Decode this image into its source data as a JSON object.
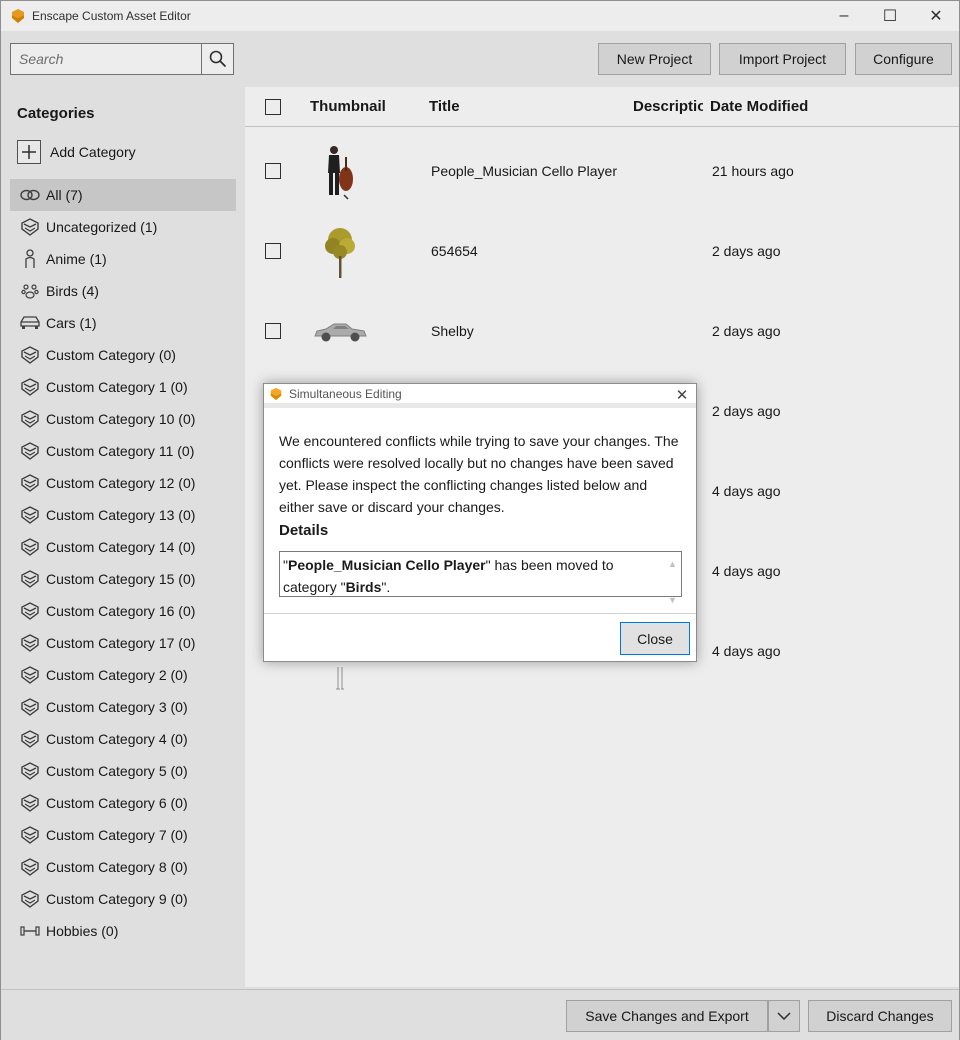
{
  "window": {
    "title": "Enscape Custom Asset Editor",
    "accent": "#f5a623"
  },
  "toolbar": {
    "search_placeholder": "Search",
    "new_project": "New Project",
    "import_project": "Import Project",
    "configure": "Configure"
  },
  "sidebar": {
    "heading": "Categories",
    "add_category": "Add Category",
    "items": [
      {
        "label": "All (7)",
        "icon": "link-icon"
      },
      {
        "label": "Uncategorized (1)",
        "icon": "category-icon"
      },
      {
        "label": "Anime (1)",
        "icon": "person-icon"
      },
      {
        "label": "Birds (4)",
        "icon": "paw-icon"
      },
      {
        "label": "Cars (1)",
        "icon": "car-icon"
      },
      {
        "label": "Custom Category (0)",
        "icon": "category-icon"
      },
      {
        "label": "Custom Category 1 (0)",
        "icon": "category-icon"
      },
      {
        "label": "Custom Category 10 (0)",
        "icon": "category-icon"
      },
      {
        "label": "Custom Category 11 (0)",
        "icon": "category-icon"
      },
      {
        "label": "Custom Category 12 (0)",
        "icon": "category-icon"
      },
      {
        "label": "Custom Category 13 (0)",
        "icon": "category-icon"
      },
      {
        "label": "Custom Category 14 (0)",
        "icon": "category-icon"
      },
      {
        "label": "Custom Category 15 (0)",
        "icon": "category-icon"
      },
      {
        "label": "Custom Category 16 (0)",
        "icon": "category-icon"
      },
      {
        "label": "Custom Category 17 (0)",
        "icon": "category-icon"
      },
      {
        "label": "Custom Category 2 (0)",
        "icon": "category-icon"
      },
      {
        "label": "Custom Category 3 (0)",
        "icon": "category-icon"
      },
      {
        "label": "Custom Category 4 (0)",
        "icon": "category-icon"
      },
      {
        "label": "Custom Category 5 (0)",
        "icon": "category-icon"
      },
      {
        "label": "Custom Category 6 (0)",
        "icon": "category-icon"
      },
      {
        "label": "Custom Category 7 (0)",
        "icon": "category-icon"
      },
      {
        "label": "Custom Category 8 (0)",
        "icon": "category-icon"
      },
      {
        "label": "Custom Category 9 (0)",
        "icon": "category-icon"
      },
      {
        "label": "Hobbies (0)",
        "icon": "dumbbell-icon"
      }
    ]
  },
  "grid": {
    "columns": {
      "thumbnail": "Thumbnail",
      "title": "Title",
      "description": "Descriptio",
      "date_modified": "Date Modified"
    },
    "rows": [
      {
        "title": "People_Musician Cello Player",
        "date": "21 hours ago",
        "thumb": "cello-player"
      },
      {
        "title": "654654",
        "date": "2 days ago",
        "thumb": "tree"
      },
      {
        "title": "Shelby",
        "date": "2 days ago",
        "thumb": "car"
      },
      {
        "title": "",
        "date": "2 days ago",
        "thumb": ""
      },
      {
        "title": "",
        "date": "4 days ago",
        "thumb": ""
      },
      {
        "title": "",
        "date": "4 days ago",
        "thumb": ""
      },
      {
        "title": "",
        "date": "4 days ago",
        "thumb": "figure"
      }
    ]
  },
  "bottombar": {
    "save_export": "Save Changes and Export",
    "discard": "Discard Changes"
  },
  "dialog": {
    "title": "Simultaneous Editing",
    "body": "We encountered conflicts while trying to save your changes. The conflicts were resolved locally but no changes have been saved yet. Please inspect the conflicting changes listed below and either save or discard your changes.",
    "details_heading": "Details",
    "detail": {
      "q1": "\"",
      "asset": "People_Musician Cello Player",
      "mid": "\" has been moved to category \"",
      "category": "Birds",
      "end": "\"."
    },
    "close_button": "Close"
  }
}
